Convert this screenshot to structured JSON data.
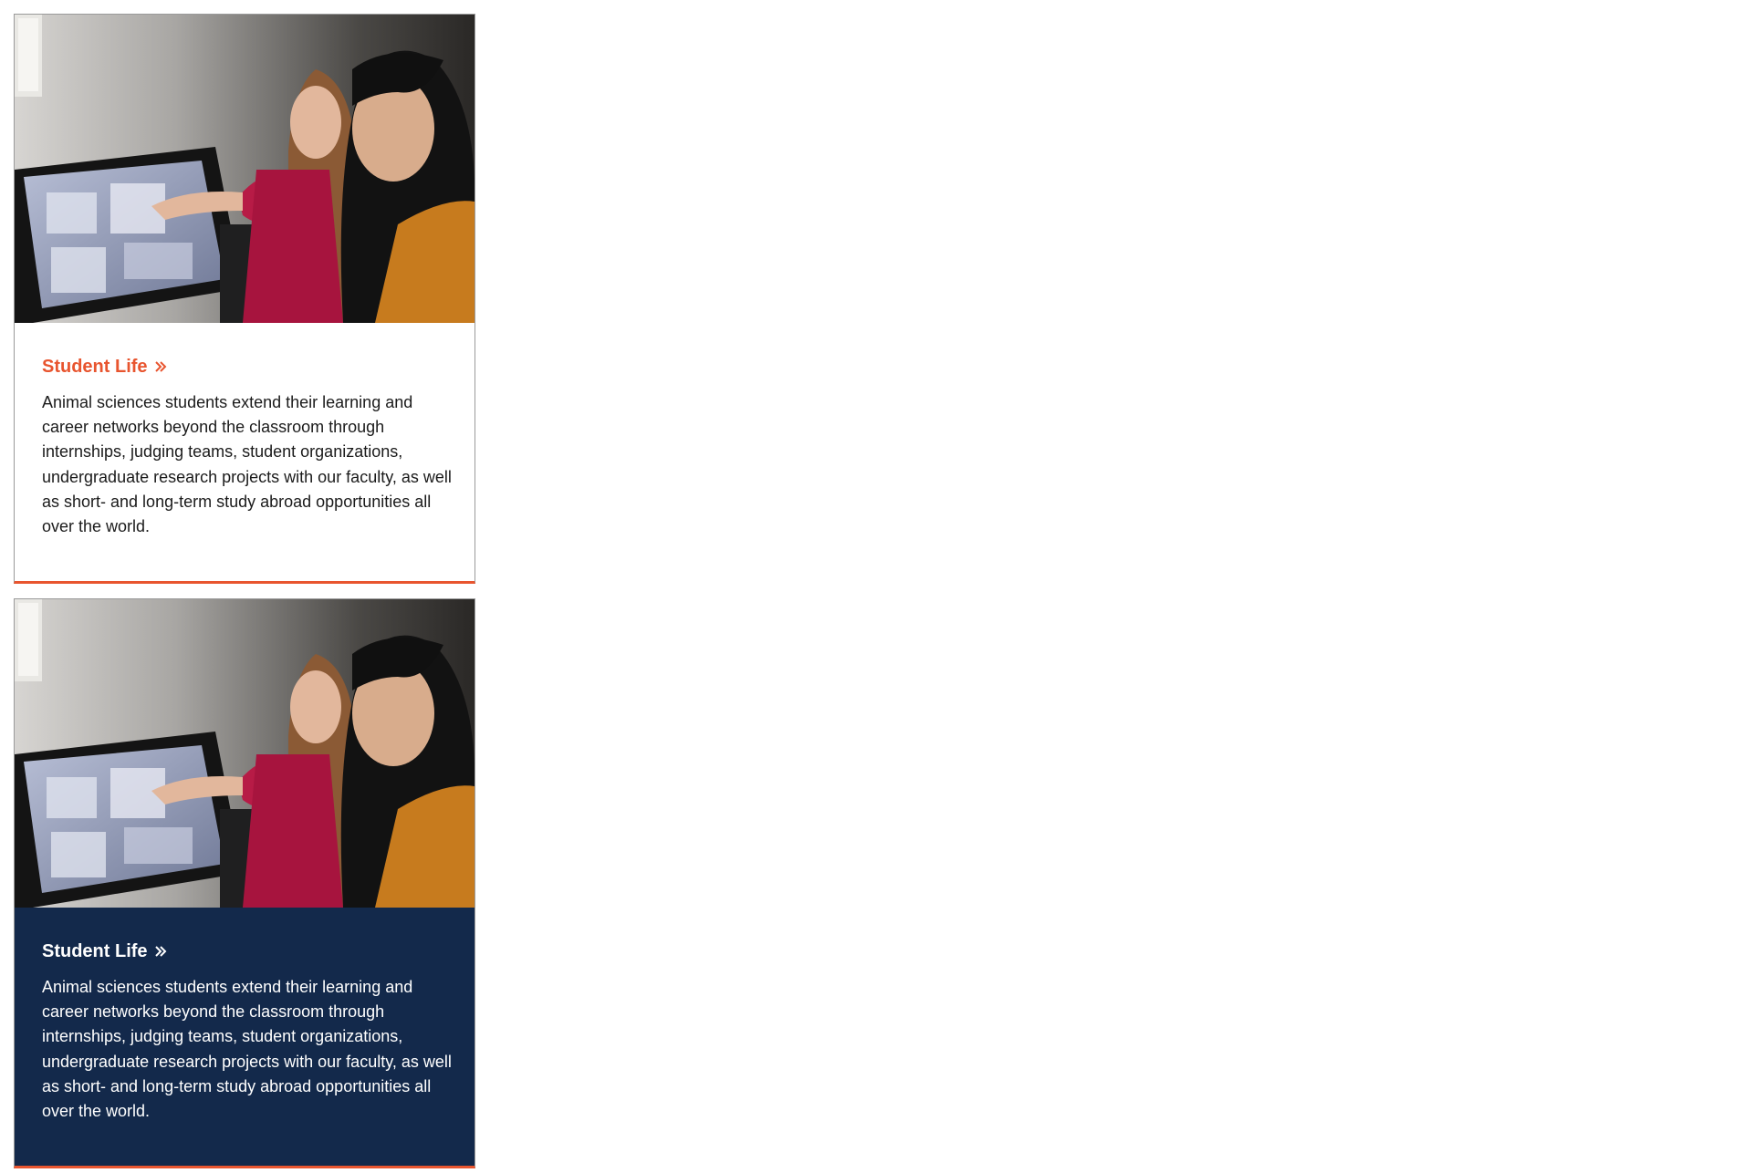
{
  "colors": {
    "accent": "#e8552f",
    "navy": "#13294b",
    "text_dark": "#1b1b1b",
    "text_light": "#ffffff"
  },
  "cards": [
    {
      "variant": "light",
      "image_alt": "Two students examining a 3D scan on a large touchscreen display",
      "title": "Student Life",
      "title_icon": "double-chevron-right-icon",
      "description": "Animal sciences students extend their learning and career networks beyond the classroom through internships, judging teams, student organizations, undergraduate research projects with our faculty, as well as short- and long-term study abroad opportunities all over the world."
    },
    {
      "variant": "dark",
      "image_alt": "Two students examining a 3D scan on a large touchscreen display",
      "title": "Student Life",
      "title_icon": "double-chevron-right-icon",
      "description": "Animal sciences students extend their learning and career networks beyond the classroom through internships, judging teams, student organizations, undergraduate research projects with our faculty, as well as short- and long-term study abroad opportunities all over the world."
    }
  ]
}
